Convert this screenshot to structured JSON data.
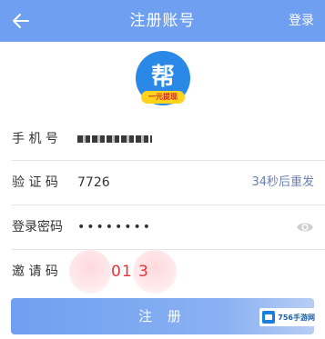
{
  "header": {
    "title": "注册账号",
    "login_label": "登录"
  },
  "logo": {
    "char": "帮",
    "badge_text": "一元提现"
  },
  "form": {
    "phone": {
      "label": "手 机 号"
    },
    "code": {
      "label": "验 证 码",
      "value": "7726",
      "resend_label": "34秒后重发"
    },
    "password": {
      "label": "登录密码",
      "value": "••••••••"
    },
    "invite": {
      "label": "邀 请 码",
      "value": "01  3"
    }
  },
  "register_label": "注 册",
  "watermark": {
    "text": "756手游网"
  },
  "colors": {
    "primary": "#6f9ff0",
    "invite_text": "#e8343a",
    "resend_text": "#6b7fb0"
  }
}
